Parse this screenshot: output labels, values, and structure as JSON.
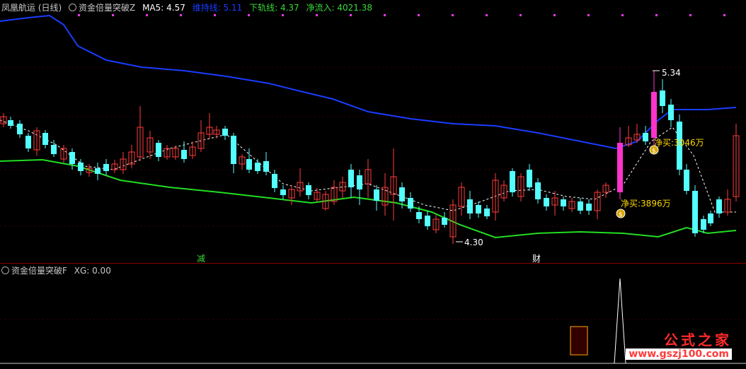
{
  "header": {
    "stock_name": "凤凰航运 (日线)",
    "indicator_name": "资金倍量突破Z",
    "ma5": "MA5: 4.57",
    "upper_line": "维持线: 5.11",
    "lower_line": "下轨线: 4.37",
    "net_inflow": "净流入: 4021.38"
  },
  "sub_header": {
    "indicator_name": "资金倍量突破F",
    "xg": "XG: 0.00"
  },
  "annotations": {
    "high_label": "5.34",
    "low_label": "4.30",
    "buy_label_1": "净买:3896万",
    "buy_label_2": "净买:3046万",
    "marker_1": "减",
    "marker_2": "财"
  },
  "watermark": {
    "brand": "公式之家",
    "url": "www.gszj100.com"
  },
  "colors": {
    "up": "#ff3b3b",
    "down": "#54ffff",
    "upper_band": "#1a3cff",
    "lower_band": "#22dd22",
    "ma": "#ffffff",
    "signal": "#ff33cc"
  }
}
